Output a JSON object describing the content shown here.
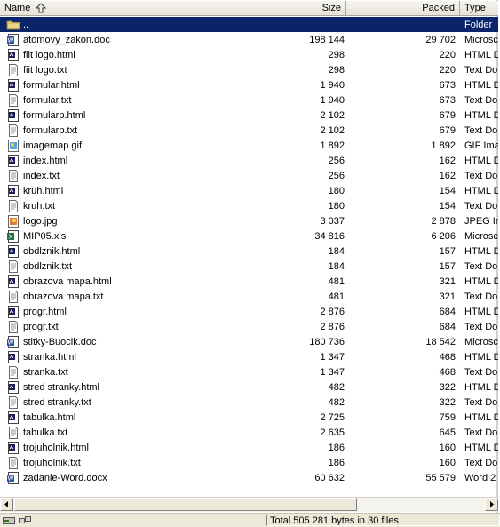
{
  "columns": {
    "name": "Name",
    "size": "Size",
    "packed": "Packed",
    "type": "Type"
  },
  "rows": [
    {
      "name": "..",
      "size": "",
      "packed": "",
      "type": "Folder",
      "icon": "folder-up-icon"
    },
    {
      "name": "atomovy_zakon.doc",
      "size": "198 144",
      "packed": "29 702",
      "type": "Microsc",
      "icon": "word-doc-icon"
    },
    {
      "name": "fiit logo.html",
      "size": "298",
      "packed": "220",
      "type": "HTML D",
      "icon": "html-file-icon"
    },
    {
      "name": "fiit logo.txt",
      "size": "298",
      "packed": "220",
      "type": "Text Do",
      "icon": "text-file-icon"
    },
    {
      "name": "formular.html",
      "size": "1 940",
      "packed": "673",
      "type": "HTML D",
      "icon": "html-file-icon"
    },
    {
      "name": "formular.txt",
      "size": "1 940",
      "packed": "673",
      "type": "Text Do",
      "icon": "text-file-icon"
    },
    {
      "name": "formularp.html",
      "size": "2 102",
      "packed": "679",
      "type": "HTML D",
      "icon": "html-file-icon"
    },
    {
      "name": "formularp.txt",
      "size": "2 102",
      "packed": "679",
      "type": "Text Do",
      "icon": "text-file-icon"
    },
    {
      "name": "imagemap.gif",
      "size": "1 892",
      "packed": "1 892",
      "type": "GIF Ima",
      "icon": "gif-image-icon"
    },
    {
      "name": "index.html",
      "size": "256",
      "packed": "162",
      "type": "HTML D",
      "icon": "html-file-icon"
    },
    {
      "name": "index.txt",
      "size": "256",
      "packed": "162",
      "type": "Text Do",
      "icon": "text-file-icon"
    },
    {
      "name": "kruh.html",
      "size": "180",
      "packed": "154",
      "type": "HTML D",
      "icon": "html-file-icon"
    },
    {
      "name": "kruh.txt",
      "size": "180",
      "packed": "154",
      "type": "Text Do",
      "icon": "text-file-icon"
    },
    {
      "name": "logo.jpg",
      "size": "3 037",
      "packed": "2 878",
      "type": "JPEG In",
      "icon": "jpeg-image-icon"
    },
    {
      "name": "MIP05.xls",
      "size": "34 816",
      "packed": "6 206",
      "type": "Microsc",
      "icon": "excel-file-icon"
    },
    {
      "name": "obdlznik.html",
      "size": "184",
      "packed": "157",
      "type": "HTML D",
      "icon": "html-file-icon"
    },
    {
      "name": "obdlznik.txt",
      "size": "184",
      "packed": "157",
      "type": "Text Do",
      "icon": "text-file-icon"
    },
    {
      "name": "obrazova mapa.html",
      "size": "481",
      "packed": "321",
      "type": "HTML D",
      "icon": "html-file-icon"
    },
    {
      "name": "obrazova mapa.txt",
      "size": "481",
      "packed": "321",
      "type": "Text Do",
      "icon": "text-file-icon"
    },
    {
      "name": "progr.html",
      "size": "2 876",
      "packed": "684",
      "type": "HTML D",
      "icon": "html-file-icon"
    },
    {
      "name": "progr.txt",
      "size": "2 876",
      "packed": "684",
      "type": "Text Do",
      "icon": "text-file-icon"
    },
    {
      "name": "stitky-Buocik.doc",
      "size": "180 736",
      "packed": "18 542",
      "type": "Microsc",
      "icon": "word-doc-icon"
    },
    {
      "name": "stranka.html",
      "size": "1 347",
      "packed": "468",
      "type": "HTML D",
      "icon": "html-file-icon"
    },
    {
      "name": "stranka.txt",
      "size": "1 347",
      "packed": "468",
      "type": "Text Do",
      "icon": "text-file-icon"
    },
    {
      "name": "stred stranky.html",
      "size": "482",
      "packed": "322",
      "type": "HTML D",
      "icon": "html-file-icon"
    },
    {
      "name": "stred stranky.txt",
      "size": "482",
      "packed": "322",
      "type": "Text Do",
      "icon": "text-file-icon"
    },
    {
      "name": "tabulka.html",
      "size": "2 725",
      "packed": "759",
      "type": "HTML D",
      "icon": "html-file-icon"
    },
    {
      "name": "tabulka.txt",
      "size": "2 635",
      "packed": "645",
      "type": "Text Do",
      "icon": "text-file-icon"
    },
    {
      "name": "trojuholnik.html",
      "size": "186",
      "packed": "160",
      "type": "HTML D",
      "icon": "html-file-icon"
    },
    {
      "name": "trojuholnik.txt",
      "size": "186",
      "packed": "160",
      "type": "Text Do",
      "icon": "text-file-icon"
    },
    {
      "name": "zadanie-Word.docx",
      "size": "60 632",
      "packed": "55 579",
      "type": "Word 2",
      "icon": "word-doc-icon"
    }
  ],
  "selected_row": 0,
  "status": {
    "text": "Total 505 281 bytes in 30 files"
  },
  "colors": {
    "selection": "#0a246a",
    "header_bg": "#ece9d8"
  }
}
